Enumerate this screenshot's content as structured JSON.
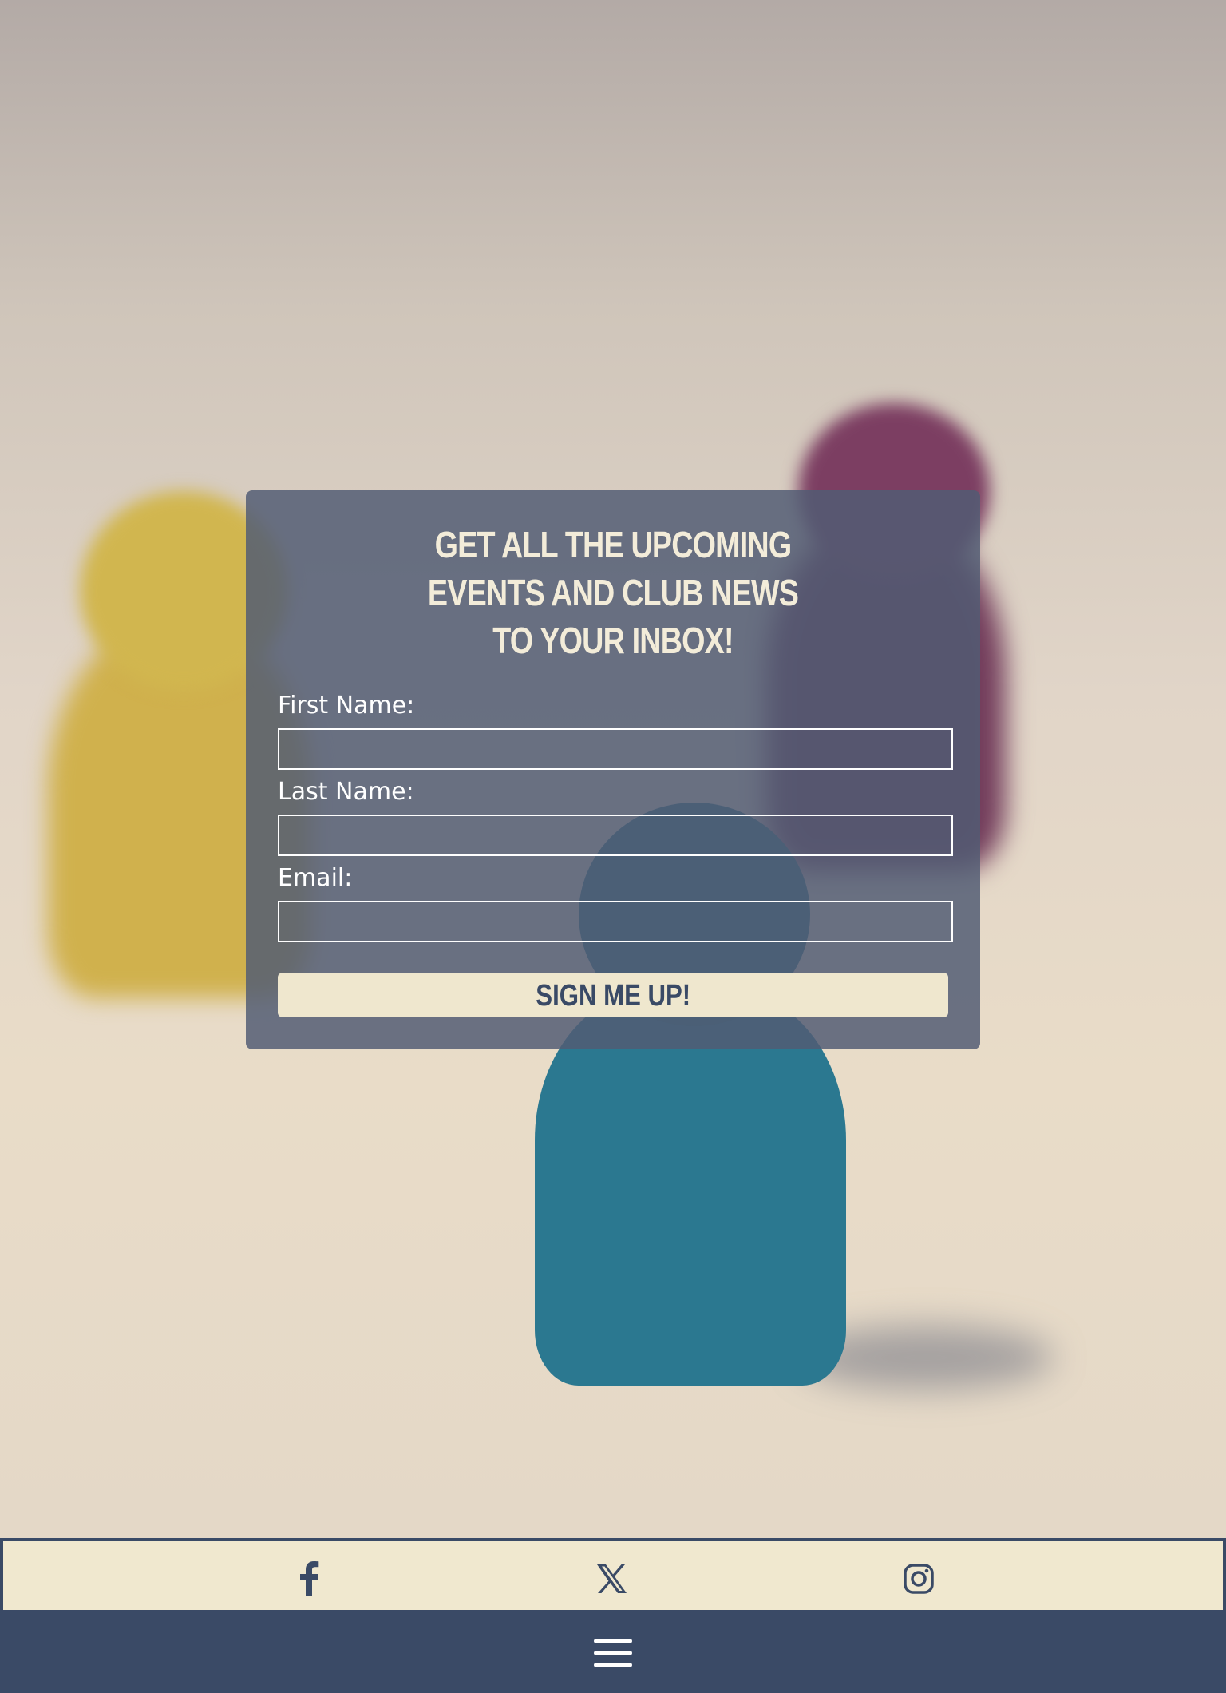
{
  "signup": {
    "title": "GET ALL THE UPCOMING\nEVENTS AND CLUB NEWS\nTO YOUR INBOX!",
    "first_name_label": "First Name:",
    "first_name_value": "",
    "last_name_label": "Last Name:",
    "last_name_value": "",
    "email_label": "Email:",
    "email_value": "",
    "submit_label": "SIGN ME UP!"
  },
  "social": {
    "items": [
      {
        "name": "facebook-icon"
      },
      {
        "name": "x-icon"
      },
      {
        "name": "instagram-icon"
      }
    ]
  },
  "menu": {
    "icon": "hamburger-menu-icon"
  },
  "colors": {
    "navy": "#3a4a66",
    "cream": "#f0e8cf",
    "card_overlay": "#515c73"
  }
}
